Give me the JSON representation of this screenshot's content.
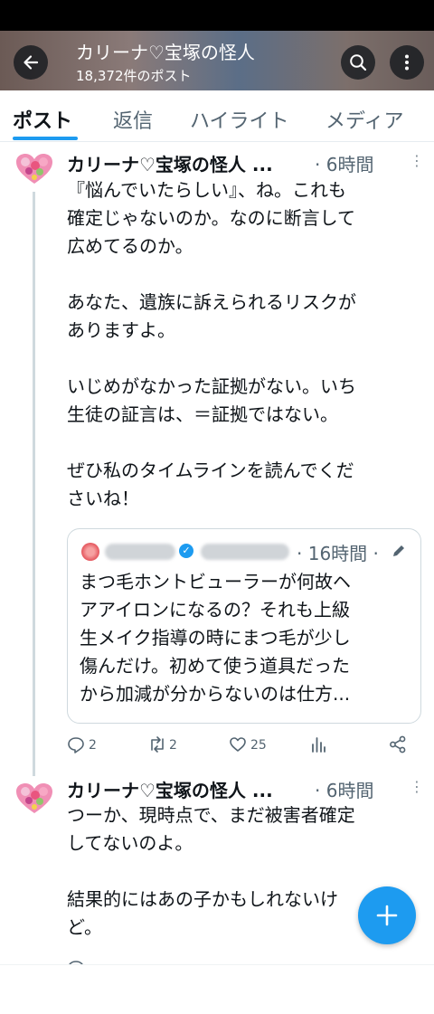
{
  "header": {
    "title": "カリーナ♡宝塚の怪人",
    "post_count": "18,372件のポスト"
  },
  "tabs": [
    "ポスト",
    "返信",
    "ハイライト",
    "メディア"
  ],
  "posts": [
    {
      "name": "カリーナ♡宝塚の怪人 ...",
      "time": "· 6時間",
      "body": "『悩んでいたらしい』、ね。これも\n確定じゃないのか。なのに断言して\n広めてるのか。\n\nあなた、遺族に訴えられるリスクが\nありますよ。\n\nいじめがなかった証拠がない。いち\n生徒の証言は、＝証拠ではない。\n\nぜひ私のタイムラインを読んでくだ\nさいね！",
      "quote": {
        "time": "· 16時間 ·",
        "body": "まつ毛ホントビューラーが何故ヘ\nアアイロンになるの？それも上級\n生メイク指導の時にまつ毛が少し\n傷んだけ。初めて使う道具だった\nから加減が分からないのは仕方..."
      },
      "replies": "2",
      "reposts": "2",
      "likes": "25"
    },
    {
      "name": "カリーナ♡宝塚の怪人 ...",
      "time": "· 6時間",
      "body": "つーか、現時点で、まだ被害者確定\nしてないのよ。\n\n結果的にはあの子かもしれないけ\nど。"
    }
  ],
  "colors": {
    "accent": "#1d9bf0",
    "text": "#0f1419",
    "muted": "#536471"
  },
  "icons": [
    "back-arrow-icon",
    "search-icon",
    "more-vertical-icon",
    "reply-icon",
    "repost-icon",
    "like-icon",
    "analytics-icon",
    "share-icon",
    "pen-icon",
    "verified-icon",
    "compose-plus-icon"
  ]
}
